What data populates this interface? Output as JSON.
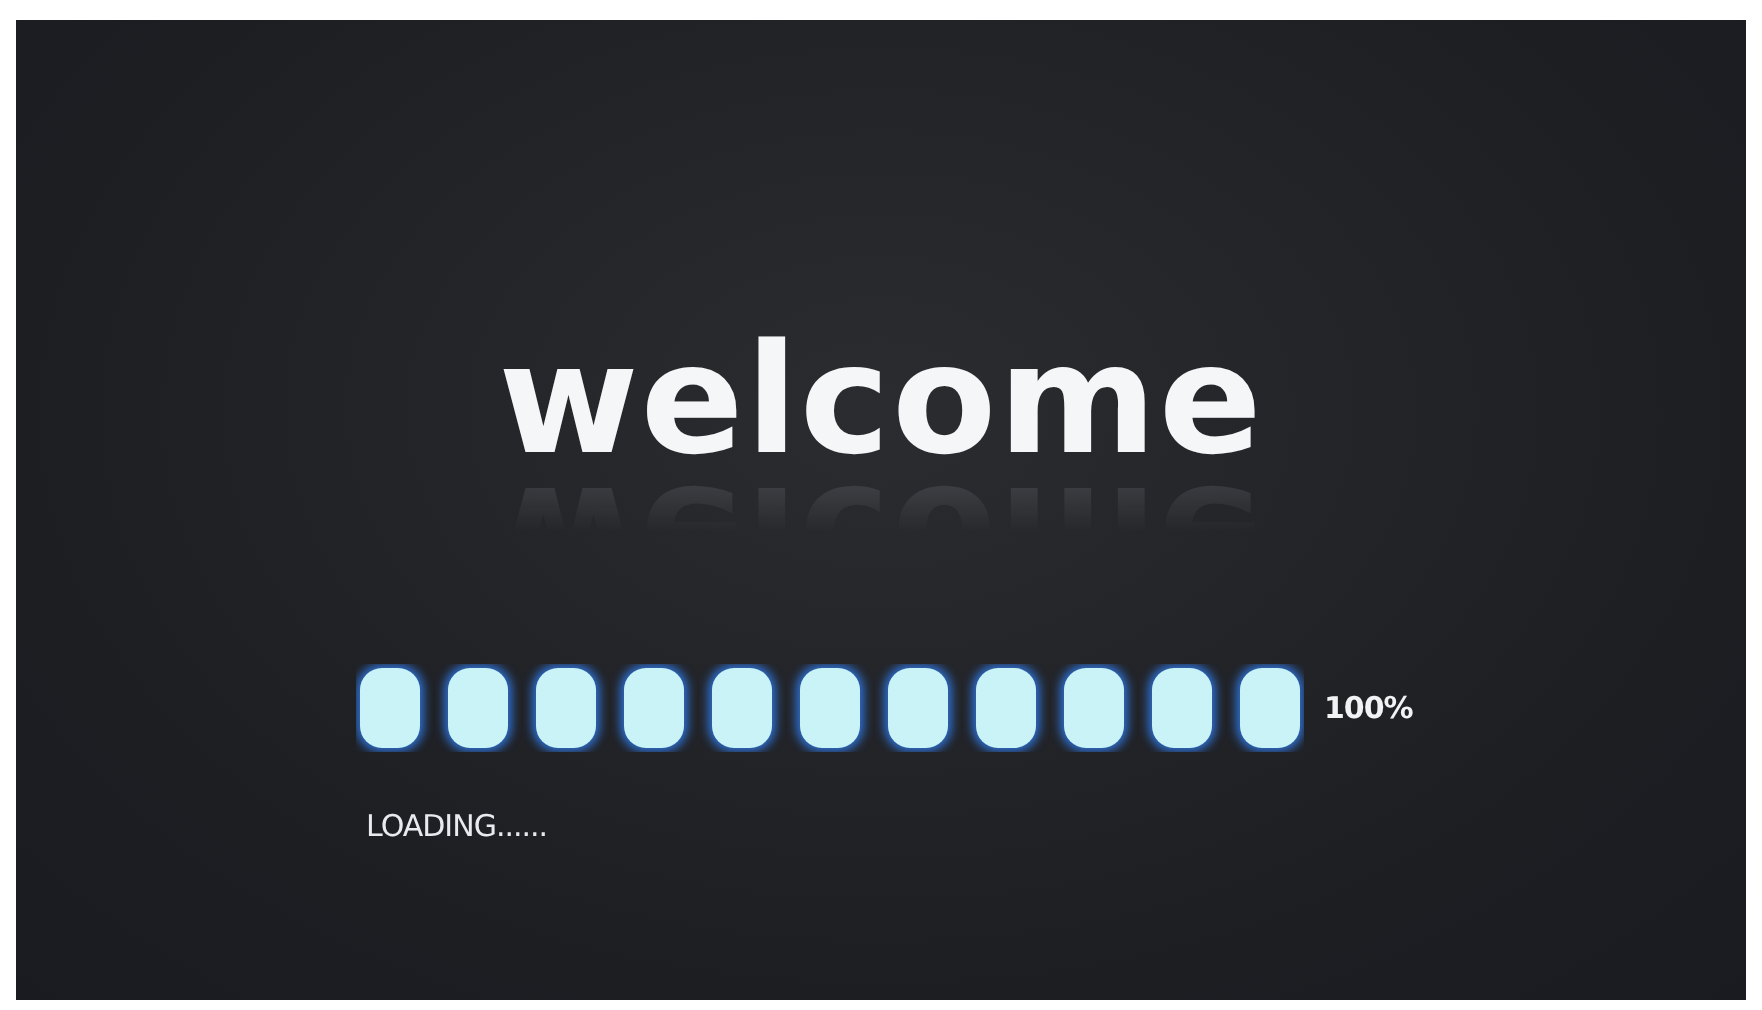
{
  "title": "welcome",
  "progress": {
    "level": 1.0,
    "reading": "100%"
  },
  "status": "LOADING......"
}
